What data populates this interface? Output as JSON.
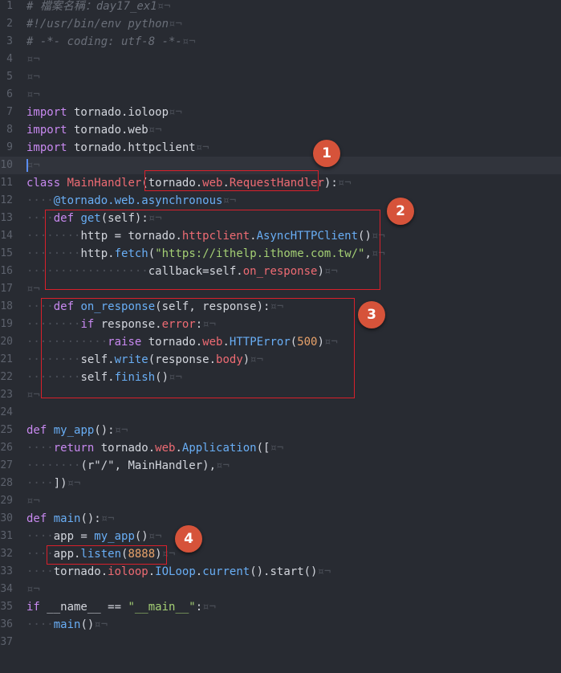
{
  "editor": {
    "active_line": 10,
    "lines": [
      {
        "no": "1",
        "tokens": [
          {
            "t": "# 檔案名稱：day17_ex1",
            "c": "cm"
          },
          {
            "t": "¤¬",
            "c": "inv"
          }
        ]
      },
      {
        "no": "2",
        "tokens": [
          {
            "t": "#!/usr/bin/env python",
            "c": "cm"
          },
          {
            "t": "¤¬",
            "c": "inv"
          }
        ]
      },
      {
        "no": "3",
        "tokens": [
          {
            "t": "# -*- coding: utf-8 -*-",
            "c": "cm"
          },
          {
            "t": "¤¬",
            "c": "inv"
          }
        ]
      },
      {
        "no": "4",
        "tokens": [
          {
            "t": "¤¬",
            "c": "inv"
          }
        ]
      },
      {
        "no": "5",
        "tokens": [
          {
            "t": "¤¬",
            "c": "inv"
          }
        ]
      },
      {
        "no": "6",
        "tokens": [
          {
            "t": "¤¬",
            "c": "inv"
          }
        ]
      },
      {
        "no": "7",
        "tokens": [
          {
            "t": "import",
            "c": "kw"
          },
          {
            "t": " tornado.ioloop",
            "c": "pl"
          },
          {
            "t": "¤¬",
            "c": "inv"
          }
        ]
      },
      {
        "no": "8",
        "tokens": [
          {
            "t": "import",
            "c": "kw"
          },
          {
            "t": " tornado.web",
            "c": "pl"
          },
          {
            "t": "¤¬",
            "c": "inv"
          }
        ]
      },
      {
        "no": "9",
        "tokens": [
          {
            "t": "import",
            "c": "kw"
          },
          {
            "t": " tornado.httpclient",
            "c": "pl"
          },
          {
            "t": "¤¬",
            "c": "inv"
          }
        ]
      },
      {
        "no": "10",
        "tokens": [
          {
            "t": "¤¬",
            "c": "inv"
          }
        ]
      },
      {
        "no": "11",
        "tokens": [
          {
            "t": "class",
            "c": "kw"
          },
          {
            "t": " ",
            "c": "pl"
          },
          {
            "t": "MainHandler",
            "c": "red"
          },
          {
            "t": "(tornado.",
            "c": "pl"
          },
          {
            "t": "web",
            "c": "red"
          },
          {
            "t": ".",
            "c": "pl"
          },
          {
            "t": "RequestHandler",
            "c": "red"
          },
          {
            "t": "):",
            "c": "pl"
          },
          {
            "t": "¤¬",
            "c": "inv"
          }
        ]
      },
      {
        "no": "12",
        "tokens": [
          {
            "t": "····",
            "c": "inv"
          },
          {
            "t": "@tornado.web.asynchronous",
            "c": "dec"
          },
          {
            "t": "¤¬",
            "c": "inv"
          }
        ]
      },
      {
        "no": "13",
        "tokens": [
          {
            "t": "····",
            "c": "inv"
          },
          {
            "t": "def",
            "c": "kw"
          },
          {
            "t": " ",
            "c": "pl"
          },
          {
            "t": "get",
            "c": "fn"
          },
          {
            "t": "(self):",
            "c": "pl"
          },
          {
            "t": "¤¬",
            "c": "inv"
          }
        ]
      },
      {
        "no": "14",
        "tokens": [
          {
            "t": "········",
            "c": "inv"
          },
          {
            "t": "http = tornado.",
            "c": "pl"
          },
          {
            "t": "httpclient",
            "c": "red"
          },
          {
            "t": ".",
            "c": "pl"
          },
          {
            "t": "AsyncHTTPClient",
            "c": "fn"
          },
          {
            "t": "()",
            "c": "pl"
          },
          {
            "t": "¤¬",
            "c": "inv"
          }
        ]
      },
      {
        "no": "15",
        "tokens": [
          {
            "t": "········",
            "c": "inv"
          },
          {
            "t": "http.",
            "c": "pl"
          },
          {
            "t": "fetch",
            "c": "fn"
          },
          {
            "t": "(",
            "c": "pl"
          },
          {
            "t": "\"https://ithelp.ithome.com.tw/\"",
            "c": "str"
          },
          {
            "t": ",",
            "c": "pl"
          },
          {
            "t": "¤¬",
            "c": "inv"
          }
        ]
      },
      {
        "no": "16",
        "tokens": [
          {
            "t": "··················",
            "c": "inv"
          },
          {
            "t": "callback=self.",
            "c": "pl"
          },
          {
            "t": "on_response",
            "c": "red"
          },
          {
            "t": ")",
            "c": "pl"
          },
          {
            "t": "¤¬",
            "c": "inv"
          }
        ]
      },
      {
        "no": "17",
        "tokens": [
          {
            "t": "¤¬",
            "c": "inv"
          }
        ]
      },
      {
        "no": "18",
        "tokens": [
          {
            "t": "····",
            "c": "inv"
          },
          {
            "t": "def",
            "c": "kw"
          },
          {
            "t": " ",
            "c": "pl"
          },
          {
            "t": "on_response",
            "c": "fn"
          },
          {
            "t": "(self, response):",
            "c": "pl"
          },
          {
            "t": "¤¬",
            "c": "inv"
          }
        ]
      },
      {
        "no": "19",
        "tokens": [
          {
            "t": "········",
            "c": "inv"
          },
          {
            "t": "if",
            "c": "kw"
          },
          {
            "t": " response.",
            "c": "pl"
          },
          {
            "t": "error",
            "c": "red"
          },
          {
            "t": ":",
            "c": "pl"
          },
          {
            "t": "¤¬",
            "c": "inv"
          }
        ]
      },
      {
        "no": "20",
        "tokens": [
          {
            "t": "············",
            "c": "inv"
          },
          {
            "t": "raise",
            "c": "kw"
          },
          {
            "t": " tornado.",
            "c": "pl"
          },
          {
            "t": "web",
            "c": "red"
          },
          {
            "t": ".",
            "c": "pl"
          },
          {
            "t": "HTTPError",
            "c": "fn"
          },
          {
            "t": "(",
            "c": "pl"
          },
          {
            "t": "500",
            "c": "num"
          },
          {
            "t": ")",
            "c": "pl"
          },
          {
            "t": "¤¬",
            "c": "inv"
          }
        ]
      },
      {
        "no": "21",
        "tokens": [
          {
            "t": "········",
            "c": "inv"
          },
          {
            "t": "self.",
            "c": "pl"
          },
          {
            "t": "write",
            "c": "fn"
          },
          {
            "t": "(response.",
            "c": "pl"
          },
          {
            "t": "body",
            "c": "red"
          },
          {
            "t": ")",
            "c": "pl"
          },
          {
            "t": "¤¬",
            "c": "inv"
          }
        ]
      },
      {
        "no": "22",
        "tokens": [
          {
            "t": "········",
            "c": "inv"
          },
          {
            "t": "self.",
            "c": "pl"
          },
          {
            "t": "finish",
            "c": "fn"
          },
          {
            "t": "()",
            "c": "pl"
          },
          {
            "t": "¤¬",
            "c": "inv"
          }
        ]
      },
      {
        "no": "23",
        "tokens": [
          {
            "t": "¤¬",
            "c": "inv"
          }
        ]
      },
      {
        "no": "24",
        "tokens": []
      },
      {
        "no": "25",
        "tokens": [
          {
            "t": "def",
            "c": "kw"
          },
          {
            "t": " ",
            "c": "pl"
          },
          {
            "t": "my_app",
            "c": "fn"
          },
          {
            "t": "():",
            "c": "pl"
          },
          {
            "t": "¤¬",
            "c": "inv"
          }
        ]
      },
      {
        "no": "26",
        "tokens": [
          {
            "t": "····",
            "c": "inv"
          },
          {
            "t": "return",
            "c": "kw"
          },
          {
            "t": " tornado.",
            "c": "pl"
          },
          {
            "t": "web",
            "c": "red"
          },
          {
            "t": ".",
            "c": "pl"
          },
          {
            "t": "Application",
            "c": "fn"
          },
          {
            "t": "([",
            "c": "pl"
          },
          {
            "t": "¤¬",
            "c": "inv"
          }
        ]
      },
      {
        "no": "27",
        "tokens": [
          {
            "t": "········",
            "c": "inv"
          },
          {
            "t": "(r\"/\", MainHandler),",
            "c": "pl"
          },
          {
            "t": "¤¬",
            "c": "inv"
          }
        ]
      },
      {
        "no": "28",
        "tokens": [
          {
            "t": "····",
            "c": "inv"
          },
          {
            "t": "])",
            "c": "pl"
          },
          {
            "t": "¤¬",
            "c": "inv"
          }
        ]
      },
      {
        "no": "29",
        "tokens": [
          {
            "t": "¤¬",
            "c": "inv"
          }
        ]
      },
      {
        "no": "30",
        "tokens": [
          {
            "t": "def",
            "c": "kw"
          },
          {
            "t": " ",
            "c": "pl"
          },
          {
            "t": "main",
            "c": "fn"
          },
          {
            "t": "():",
            "c": "pl"
          },
          {
            "t": "¤¬",
            "c": "inv"
          }
        ]
      },
      {
        "no": "31",
        "tokens": [
          {
            "t": "····",
            "c": "inv"
          },
          {
            "t": "app = ",
            "c": "pl"
          },
          {
            "t": "my_app",
            "c": "fn"
          },
          {
            "t": "()",
            "c": "pl"
          },
          {
            "t": "¤¬",
            "c": "inv"
          }
        ]
      },
      {
        "no": "32",
        "tokens": [
          {
            "t": "····",
            "c": "inv"
          },
          {
            "t": "app.",
            "c": "pl"
          },
          {
            "t": "listen",
            "c": "fn"
          },
          {
            "t": "(",
            "c": "pl"
          },
          {
            "t": "8888",
            "c": "num"
          },
          {
            "t": ")",
            "c": "pl"
          },
          {
            "t": "¤¬",
            "c": "inv"
          }
        ]
      },
      {
        "no": "33",
        "tokens": [
          {
            "t": "····",
            "c": "inv"
          },
          {
            "t": "tornado.",
            "c": "pl"
          },
          {
            "t": "ioloop",
            "c": "red"
          },
          {
            "t": ".",
            "c": "pl"
          },
          {
            "t": "IOLoop",
            "c": "fn"
          },
          {
            "t": ".",
            "c": "pl"
          },
          {
            "t": "current",
            "c": "fn"
          },
          {
            "t": "().start()",
            "c": "pl"
          },
          {
            "t": "¤¬",
            "c": "inv"
          }
        ]
      },
      {
        "no": "34",
        "tokens": [
          {
            "t": "¤¬",
            "c": "inv"
          }
        ]
      },
      {
        "no": "35",
        "tokens": [
          {
            "t": "if",
            "c": "kw"
          },
          {
            "t": " __name__ == ",
            "c": "pl"
          },
          {
            "t": "\"__main__\"",
            "c": "str"
          },
          {
            "t": ":",
            "c": "pl"
          },
          {
            "t": "¤¬",
            "c": "inv"
          }
        ]
      },
      {
        "no": "36",
        "tokens": [
          {
            "t": "····",
            "c": "inv"
          },
          {
            "t": "main",
            "c": "fn"
          },
          {
            "t": "()",
            "c": "pl"
          },
          {
            "t": "¤¬",
            "c": "inv"
          }
        ]
      },
      {
        "no": "37",
        "tokens": []
      }
    ]
  },
  "annotations": [
    {
      "label": "1"
    },
    {
      "label": "2"
    },
    {
      "label": "3"
    },
    {
      "label": "4"
    }
  ],
  "colors": {
    "background": "#282b32",
    "keyword": "#c889f0",
    "function": "#69aef5",
    "identifier_red": "#ee6b73",
    "number": "#e8a26a",
    "string": "#a4cf74",
    "comment": "#6a6f79",
    "annotation_box": "#d9202b",
    "annotation_badge": "#d6533a"
  }
}
